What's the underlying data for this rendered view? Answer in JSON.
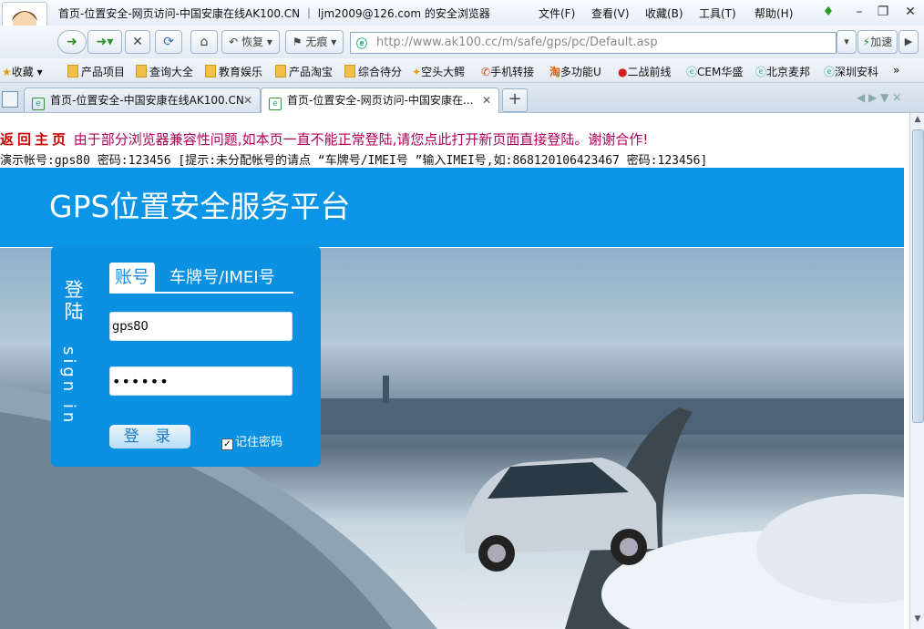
{
  "window": {
    "title": "首页-位置安全-网页访问-中国安康在线AK100.CN ｜ ljm2009@126.com 的安全浏览器",
    "menu": [
      "文件(F)",
      "查看(V)",
      "收藏(B)",
      "工具(T)",
      "帮助(H)"
    ]
  },
  "toolbar": {
    "restore_label": "恢复",
    "notrace_label": "无痕",
    "url": "http://www.ak100.cc/m/safe/gps/pc/Default.asp",
    "accelerate_label": "加速"
  },
  "bookmarks": [
    "收藏",
    "产品项目",
    "查询大全",
    "教育娱乐",
    "产品淘宝",
    "综合待分",
    "空头大鳄",
    "手机转接",
    "多功能U",
    "二战前线",
    "CEM华盛",
    "北京麦邦",
    "深圳安科",
    "»"
  ],
  "tabs": [
    {
      "label": "首页-位置安全-中国安康在线AK100.CN"
    },
    {
      "label": "首页-位置安全-网页访问-中国安康在..."
    }
  ],
  "page": {
    "home_link": "返回主页",
    "notice": "由于部分浏览器兼容性问题,如本页一直不能正常登陆,请您点此打开新页面直接登陆。谢谢合作!",
    "demo_info": "演示帐号:gps80 密码:123456 [提示:未分配帐号的请点 “车牌号/IMEI号 ”输入IMEI号,如:868120106423467 密码:123456]",
    "platform_title": "GPS位置安全服务平台"
  },
  "login": {
    "side_label": "登陆",
    "side_sign": "sign in",
    "tab_account": "账号",
    "tab_plate": "车牌号/IMEI号",
    "username": "gps80",
    "password": "••••••",
    "login_button": "登 录",
    "remember_label": "记住密码"
  }
}
